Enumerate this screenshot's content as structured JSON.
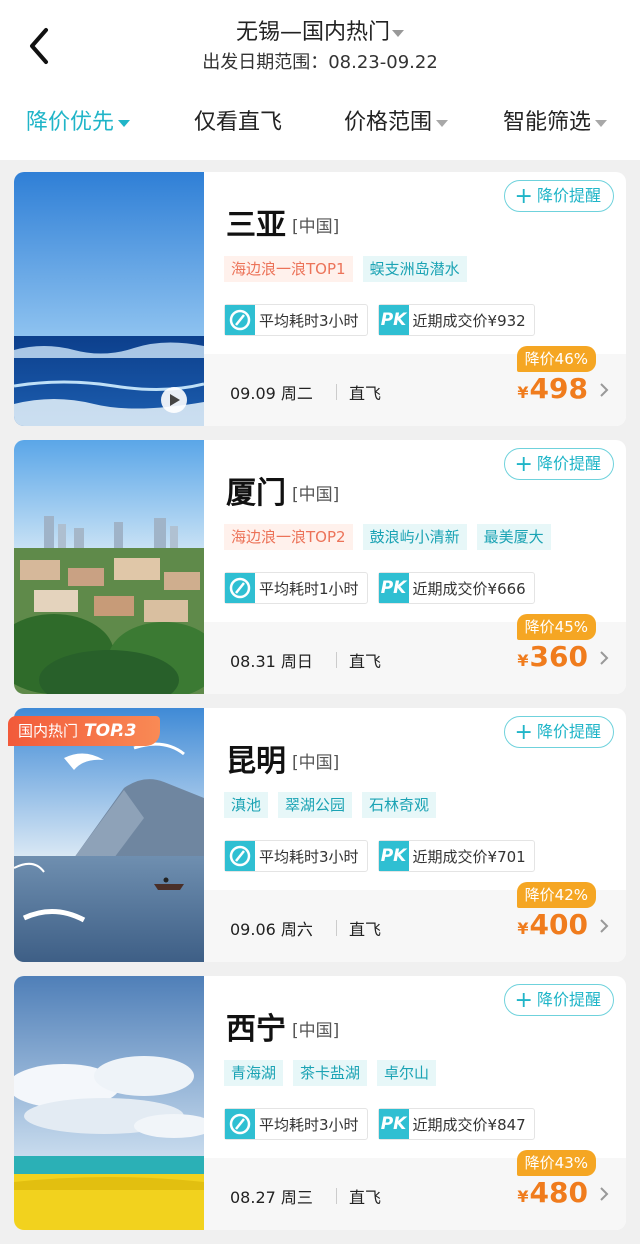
{
  "header": {
    "title": "无锡—国内热门",
    "subtitle": "出发日期范围：08.23-09.22"
  },
  "filters": [
    {
      "label": "降价优先",
      "active": true,
      "has_caret": true
    },
    {
      "label": "仅看直飞",
      "active": false,
      "has_caret": false
    },
    {
      "label": "价格范围",
      "active": false,
      "has_caret": true
    },
    {
      "label": "智能筛选",
      "active": false,
      "has_caret": true
    }
  ],
  "remind_label": "降价提醒",
  "rank_badge": {
    "prefix": "国内热门",
    "rank": "TOP.3"
  },
  "cards": [
    {
      "city": "三亚",
      "country": "[中国]",
      "tags": [
        {
          "text": "海边浪一浪TOP1",
          "style": "red"
        },
        {
          "text": "蜈支洲岛潜水",
          "style": "teal"
        }
      ],
      "avg_time": "平均耗时3小时",
      "recent_price": "近期成交价¥932",
      "date": "09.09 周二",
      "flight_type": "直飞",
      "discount": "降价46%",
      "currency": "¥",
      "price": "498"
    },
    {
      "city": "厦门",
      "country": "[中国]",
      "tags": [
        {
          "text": "海边浪一浪TOP2",
          "style": "red"
        },
        {
          "text": "鼓浪屿小清新",
          "style": "teal"
        },
        {
          "text": "最美厦大",
          "style": "teal"
        }
      ],
      "avg_time": "平均耗时1小时",
      "recent_price": "近期成交价¥666",
      "date": "08.31 周日",
      "flight_type": "直飞",
      "discount": "降价45%",
      "currency": "¥",
      "price": "360"
    },
    {
      "city": "昆明",
      "country": "[中国]",
      "tags": [
        {
          "text": "滇池",
          "style": "teal"
        },
        {
          "text": "翠湖公园",
          "style": "teal"
        },
        {
          "text": "石林奇观",
          "style": "teal"
        }
      ],
      "avg_time": "平均耗时3小时",
      "recent_price": "近期成交价¥701",
      "date": "09.06 周六",
      "flight_type": "直飞",
      "discount": "降价42%",
      "currency": "¥",
      "price": "400"
    },
    {
      "city": "西宁",
      "country": "[中国]",
      "tags": [
        {
          "text": "青海湖",
          "style": "teal"
        },
        {
          "text": "茶卡盐湖",
          "style": "teal"
        },
        {
          "text": "卓尔山",
          "style": "teal"
        }
      ],
      "avg_time": "平均耗时3小时",
      "recent_price": "近期成交价¥847",
      "date": "08.27 周三",
      "flight_type": "直飞",
      "discount": "降价43%",
      "currency": "¥",
      "price": "480"
    }
  ],
  "colors": {
    "accent": "#20b5c8",
    "price": "#f07c1d",
    "discount_bg": "#f5a623"
  }
}
